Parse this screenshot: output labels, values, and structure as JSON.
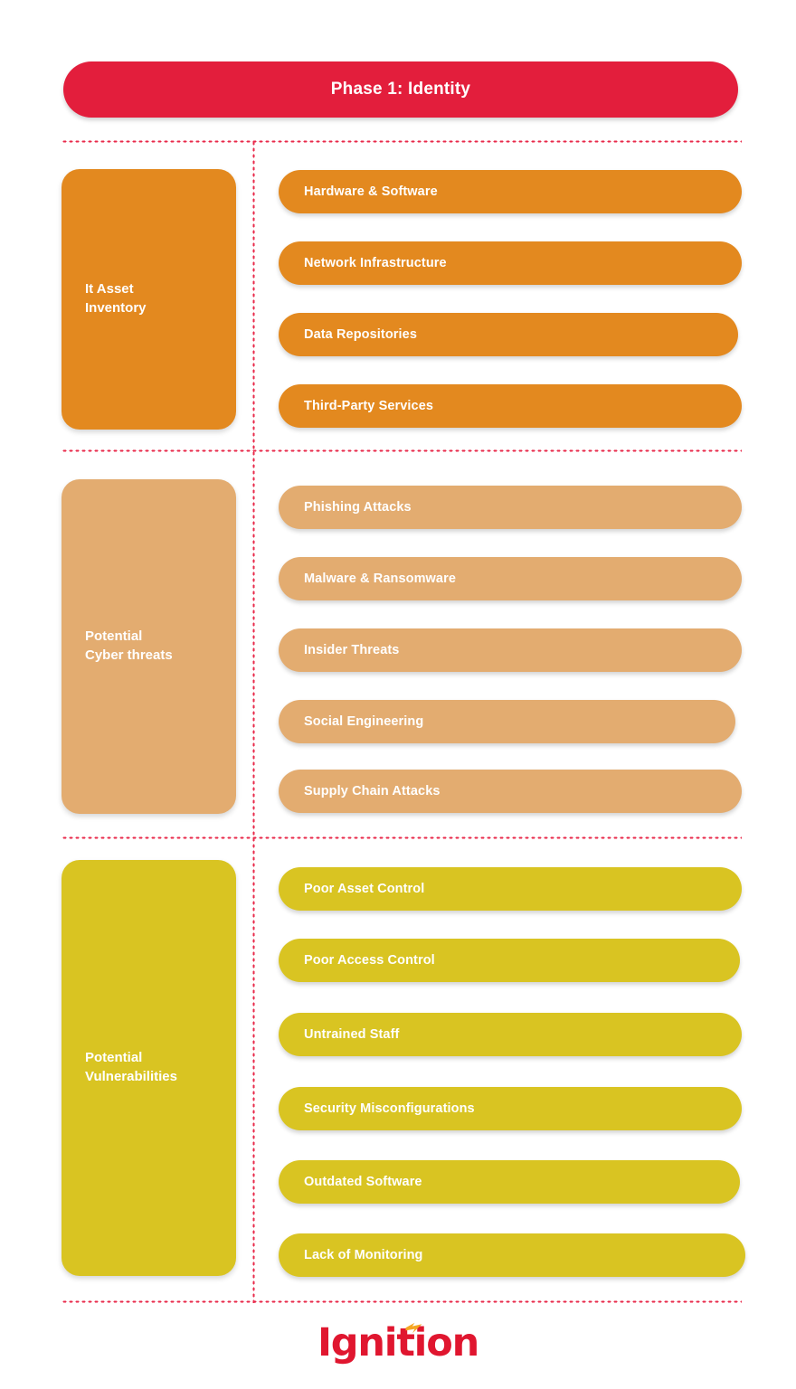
{
  "header": {
    "title": "Phase 1: Identity",
    "color": "#E31E3C"
  },
  "sections": [
    {
      "category": "It Asset\nInventory",
      "color": "#E3891F",
      "items": [
        "Hardware & Software",
        "Network Infrastructure",
        "Data Repositories",
        "Third-Party Services"
      ]
    },
    {
      "category": "Potential\nCyber threats",
      "color": "#E3AC70",
      "items": [
        "Phishing Attacks",
        "Malware & Ransomware",
        "Insider Threats",
        "Social Engineering",
        "Supply Chain Attacks"
      ]
    },
    {
      "category": "Potential\nVulnerabilities",
      "color": "#D9C422",
      "items": [
        "Poor Asset Control",
        "Poor Access Control",
        "Untrained Staff",
        "Security Misconfigurations",
        "Outdated Software",
        "Lack of Monitoring"
      ]
    }
  ],
  "divider": {
    "color": "#E8294A"
  },
  "footer": {
    "logo_text": "Ignition",
    "logo_color": "#E0162F",
    "spark_color": "#F5A623"
  }
}
